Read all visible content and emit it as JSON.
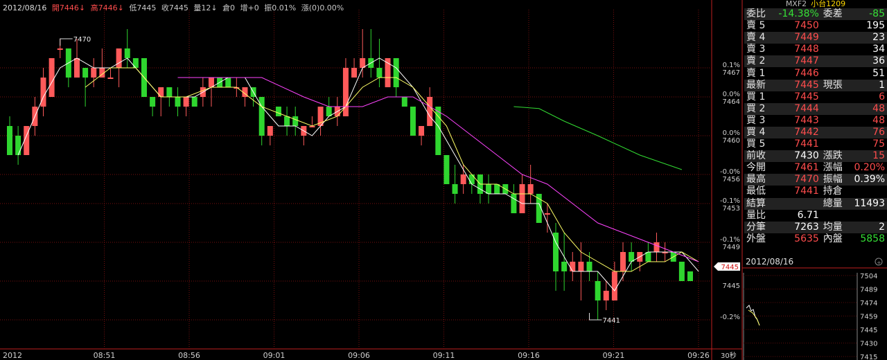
{
  "header": {
    "date": "2012/08/16",
    "open": "開7446↓",
    "high": "高7446↓",
    "low": "低7445",
    "close": "收7445",
    "volume": "量12↓",
    "oi": "倉0",
    "oi_change": "增+0",
    "amplitude": "振0.01%",
    "change": "漲(0)0.00%"
  },
  "side_panel": {
    "code": "MXF2",
    "title": "小台1209",
    "ratio_label": "委比",
    "ratio_value": "-14.38%",
    "diff_label": "委差",
    "diff_value": "-85",
    "asks": [
      {
        "label": "賣 5",
        "price": "7450",
        "qty": "195"
      },
      {
        "label": "賣 4",
        "price": "7449",
        "qty": "23"
      },
      {
        "label": "賣 3",
        "price": "7448",
        "qty": "34"
      },
      {
        "label": "賣 2",
        "price": "7447",
        "qty": "36"
      },
      {
        "label": "賣 1",
        "price": "7446",
        "qty": "51"
      }
    ],
    "last": {
      "label": "最新",
      "price": "7445",
      "qty_label": "現張",
      "qty": "1"
    },
    "bids": [
      {
        "label": "買 1",
        "price": "7445",
        "qty": "6"
      },
      {
        "label": "買 2",
        "price": "7444",
        "qty": "48"
      },
      {
        "label": "買 3",
        "price": "7443",
        "qty": "48"
      },
      {
        "label": "買 4",
        "price": "7442",
        "qty": "76"
      },
      {
        "label": "買 5",
        "price": "7441",
        "qty": "75"
      }
    ],
    "stats": {
      "prev_close_label": "前收",
      "prev_close": "7430",
      "chg_label": "漲跌",
      "chg": "15",
      "open_label": "今開",
      "open": "7461",
      "chg_pct_label": "漲幅",
      "chg_pct": "0.20%",
      "high_label": "最高",
      "high": "7470",
      "amp_label": "振幅",
      "amp": "0.39%",
      "low_label": "最低",
      "low": "7441",
      "oi_label": "持倉",
      "oi": "",
      "settle_label": "結算",
      "settle": "",
      "total_label": "總量",
      "total": "11493",
      "vol_ratio_label": "量比",
      "vol_ratio": "6.71",
      "trades_label": "分筆",
      "trades": "7263",
      "avg_label": "均量",
      "avg": "2",
      "outer_label": "外盤",
      "outer": "5635",
      "inner_label": "內盤",
      "inner": "5858"
    },
    "mini_date": "2012/08/16",
    "mini_ticks": [
      "7504",
      "7489",
      "7474",
      "7459",
      "7445",
      "7430",
      "7415"
    ]
  },
  "chart_data": {
    "type": "candlestick",
    "price_range": [
      7438,
      7473
    ],
    "y_ticks": [
      {
        "price": 7467,
        "label": "7467",
        "pct": "0.1%"
      },
      {
        "price": 7464,
        "label": "7464",
        "pct": "0.0%"
      },
      {
        "price": 7460,
        "label": "7460",
        "pct": "0.0%"
      },
      {
        "price": 7456,
        "label": "7456",
        "pct": "-0.0%"
      },
      {
        "price": 7453,
        "label": "7453",
        "pct": "-0.1%"
      },
      {
        "price": 7449,
        "label": "7449",
        "pct": "-0.1%"
      },
      {
        "price": 7445,
        "label": "7445",
        "pct": ""
      },
      {
        "price": 7441,
        "label": "",
        "pct": "-0.2%"
      }
    ],
    "current_price": "7445",
    "x_labels": [
      "2012",
      "08:51",
      "08:56",
      "09:01",
      "09:06",
      "09:11",
      "09:16",
      "09:21",
      "09:26"
    ],
    "x_unit": "30秒",
    "high_marker": "7470",
    "low_marker": "7441",
    "candles": [
      {
        "o": 7461,
        "h": 7462,
        "l": 7459,
        "c": 7458
      },
      {
        "o": 7460,
        "h": 7461,
        "l": 7457,
        "c": 7458
      },
      {
        "o": 7458,
        "h": 7461,
        "l": 7458,
        "c": 7461
      },
      {
        "o": 7461,
        "h": 7464,
        "l": 7460,
        "c": 7463
      },
      {
        "o": 7463,
        "h": 7467,
        "l": 7462,
        "c": 7466
      },
      {
        "o": 7464,
        "h": 7467,
        "l": 7464,
        "c": 7468
      },
      {
        "o": 7469,
        "h": 7470,
        "l": 7468,
        "c": 7469
      },
      {
        "o": 7469,
        "h": 7469,
        "l": 7465,
        "c": 7466
      },
      {
        "o": 7466,
        "h": 7470,
        "l": 7466,
        "c": 7468
      },
      {
        "o": 7467,
        "h": 7467,
        "l": 7463,
        "c": 7466
      },
      {
        "o": 7466,
        "h": 7468,
        "l": 7465,
        "c": 7467
      },
      {
        "o": 7466,
        "h": 7469,
        "l": 7466,
        "c": 7467
      },
      {
        "o": 7466,
        "h": 7467,
        "l": 7466,
        "c": 7466
      },
      {
        "o": 7467,
        "h": 7469,
        "l": 7465,
        "c": 7469
      },
      {
        "o": 7469,
        "h": 7471,
        "l": 7467,
        "c": 7468
      },
      {
        "o": 7468,
        "h": 7468,
        "l": 7467,
        "c": 7467
      },
      {
        "o": 7468,
        "h": 7468,
        "l": 7464,
        "c": 7464
      },
      {
        "o": 7464,
        "h": 7464,
        "l": 7462,
        "c": 7463
      },
      {
        "o": 7464,
        "h": 7465,
        "l": 7462,
        "c": 7465
      },
      {
        "o": 7465,
        "h": 7465,
        "l": 7463,
        "c": 7464
      },
      {
        "o": 7464,
        "h": 7465,
        "l": 7462,
        "c": 7463
      },
      {
        "o": 7463,
        "h": 7464,
        "l": 7462,
        "c": 7464
      },
      {
        "o": 7464,
        "h": 7464,
        "l": 7463,
        "c": 7463
      },
      {
        "o": 7464,
        "h": 7466,
        "l": 7463,
        "c": 7465
      },
      {
        "o": 7465,
        "h": 7465,
        "l": 7463,
        "c": 7466
      },
      {
        "o": 7466,
        "h": 7466,
        "l": 7465,
        "c": 7465
      },
      {
        "o": 7466,
        "h": 7466,
        "l": 7465,
        "c": 7465
      },
      {
        "o": 7465,
        "h": 7466,
        "l": 7464,
        "c": 7465
      },
      {
        "o": 7464,
        "h": 7465,
        "l": 7463,
        "c": 7465
      },
      {
        "o": 7465,
        "h": 7465,
        "l": 7463,
        "c": 7464
      },
      {
        "o": 7464,
        "h": 7464,
        "l": 7459,
        "c": 7460
      },
      {
        "o": 7460,
        "h": 7461,
        "l": 7459,
        "c": 7461
      },
      {
        "o": 7463,
        "h": 7463,
        "l": 7462,
        "c": 7462
      },
      {
        "o": 7462,
        "h": 7463,
        "l": 7460,
        "c": 7461
      },
      {
        "o": 7462,
        "h": 7463,
        "l": 7460,
        "c": 7461
      },
      {
        "o": 7460,
        "h": 7461,
        "l": 7459,
        "c": 7461
      },
      {
        "o": 7461,
        "h": 7462,
        "l": 7461,
        "c": 7461
      },
      {
        "o": 7461,
        "h": 7463,
        "l": 7460,
        "c": 7463
      },
      {
        "o": 7463,
        "h": 7464,
        "l": 7462,
        "c": 7462
      },
      {
        "o": 7462,
        "h": 7464,
        "l": 7461,
        "c": 7463
      },
      {
        "o": 7462,
        "h": 7468,
        "l": 7462,
        "c": 7467
      },
      {
        "o": 7466,
        "h": 7468,
        "l": 7466,
        "c": 7467
      },
      {
        "o": 7467,
        "h": 7471,
        "l": 7466,
        "c": 7468
      },
      {
        "o": 7468,
        "h": 7471,
        "l": 7466,
        "c": 7467
      },
      {
        "o": 7467,
        "h": 7470,
        "l": 7465,
        "c": 7466
      },
      {
        "o": 7465,
        "h": 7468,
        "l": 7465,
        "c": 7468
      },
      {
        "o": 7468,
        "h": 7468,
        "l": 7464,
        "c": 7465
      },
      {
        "o": 7464,
        "h": 7464,
        "l": 7463,
        "c": 7463
      },
      {
        "o": 7463,
        "h": 7463,
        "l": 7460,
        "c": 7460
      },
      {
        "o": 7460,
        "h": 7461,
        "l": 7459,
        "c": 7461
      },
      {
        "o": 7461,
        "h": 7465,
        "l": 7461,
        "c": 7464
      },
      {
        "o": 7463,
        "h": 7463,
        "l": 7458,
        "c": 7458
      },
      {
        "o": 7458,
        "h": 7458,
        "l": 7455,
        "c": 7455
      },
      {
        "o": 7455,
        "h": 7457,
        "l": 7453,
        "c": 7454
      },
      {
        "o": 7455,
        "h": 7457,
        "l": 7454,
        "c": 7456
      },
      {
        "o": 7456,
        "h": 7456,
        "l": 7454,
        "c": 7455
      },
      {
        "o": 7456,
        "h": 7456,
        "l": 7453,
        "c": 7454
      },
      {
        "o": 7455,
        "h": 7456,
        "l": 7453,
        "c": 7454
      },
      {
        "o": 7455,
        "h": 7455,
        "l": 7454,
        "c": 7454
      },
      {
        "o": 7455,
        "h": 7455,
        "l": 7454,
        "c": 7454
      },
      {
        "o": 7454,
        "h": 7455,
        "l": 7452,
        "c": 7452
      },
      {
        "o": 7452,
        "h": 7456,
        "l": 7452,
        "c": 7455
      },
      {
        "o": 7454,
        "h": 7457,
        "l": 7453,
        "c": 7455
      },
      {
        "o": 7454,
        "h": 7454,
        "l": 7451,
        "c": 7451
      },
      {
        "o": 7452,
        "h": 7453,
        "l": 7450,
        "c": 7452
      },
      {
        "o": 7450,
        "h": 7451,
        "l": 7444,
        "c": 7446
      },
      {
        "o": 7447,
        "h": 7450,
        "l": 7444,
        "c": 7446
      },
      {
        "o": 7446,
        "h": 7448,
        "l": 7445,
        "c": 7447
      },
      {
        "o": 7446,
        "h": 7449,
        "l": 7443,
        "c": 7447
      },
      {
        "o": 7447,
        "h": 7448,
        "l": 7445,
        "c": 7446
      },
      {
        "o": 7445,
        "h": 7446,
        "l": 7441,
        "c": 7443
      },
      {
        "o": 7443,
        "h": 7445,
        "l": 7442,
        "c": 7444
      },
      {
        "o": 7443,
        "h": 7447,
        "l": 7443,
        "c": 7446
      },
      {
        "o": 7446,
        "h": 7449,
        "l": 7445,
        "c": 7448
      },
      {
        "o": 7448,
        "h": 7449,
        "l": 7446,
        "c": 7447
      },
      {
        "o": 7447,
        "h": 7448,
        "l": 7446,
        "c": 7448
      },
      {
        "o": 7448,
        "h": 7449,
        "l": 7447,
        "c": 7447
      },
      {
        "o": 7448,
        "h": 7450,
        "l": 7447,
        "c": 7449
      },
      {
        "o": 7448,
        "h": 7449,
        "l": 7447,
        "c": 7448
      },
      {
        "o": 7448,
        "h": 7448,
        "l": 7447,
        "c": 7447
      },
      {
        "o": 7447,
        "h": 7447,
        "l": 7445,
        "c": 7445
      },
      {
        "o": 7446,
        "h": 7446,
        "l": 7445,
        "c": 7445
      }
    ],
    "ma_series": [
      {
        "color": "#ffffff",
        "points": [
          [
            1,
            7458
          ],
          [
            2,
            7460
          ],
          [
            3,
            7462
          ],
          [
            4,
            7464
          ],
          [
            6,
            7467
          ],
          [
            8,
            7468
          ],
          [
            10,
            7467
          ],
          [
            12,
            7467
          ],
          [
            14,
            7468
          ],
          [
            16,
            7466
          ],
          [
            18,
            7464
          ],
          [
            20,
            7464
          ],
          [
            22,
            7464
          ],
          [
            24,
            7465
          ],
          [
            26,
            7466
          ],
          [
            28,
            7466
          ],
          [
            30,
            7463
          ],
          [
            32,
            7461
          ],
          [
            34,
            7461
          ],
          [
            36,
            7460
          ],
          [
            38,
            7462
          ],
          [
            40,
            7463
          ],
          [
            42,
            7467
          ],
          [
            44,
            7468
          ],
          [
            46,
            7467
          ],
          [
            48,
            7465
          ],
          [
            50,
            7462
          ],
          [
            51,
            7461
          ],
          [
            53,
            7458
          ],
          [
            55,
            7455
          ],
          [
            57,
            7454
          ],
          [
            59,
            7454
          ],
          [
            61,
            7453
          ],
          [
            63,
            7453
          ],
          [
            65,
            7449
          ],
          [
            67,
            7446
          ],
          [
            69,
            7446
          ],
          [
            70,
            7446
          ],
          [
            72,
            7444
          ],
          [
            74,
            7447
          ],
          [
            76,
            7448
          ],
          [
            78,
            7448
          ],
          [
            80,
            7448
          ],
          [
            82,
            7446
          ]
        ]
      },
      {
        "color": "#ffff66",
        "points": [
          [
            9,
            7465
          ],
          [
            12,
            7467
          ],
          [
            15,
            7467
          ],
          [
            18,
            7464
          ],
          [
            21,
            7464
          ],
          [
            24,
            7465
          ],
          [
            27,
            7465
          ],
          [
            30,
            7463
          ],
          [
            33,
            7462
          ],
          [
            36,
            7461
          ],
          [
            39,
            7462
          ],
          [
            42,
            7465
          ],
          [
            44,
            7466
          ],
          [
            46,
            7466
          ],
          [
            48,
            7465
          ],
          [
            50,
            7463
          ],
          [
            52,
            7461
          ],
          [
            54,
            7457
          ],
          [
            56,
            7455
          ],
          [
            58,
            7455
          ],
          [
            60,
            7454
          ],
          [
            62,
            7454
          ],
          [
            64,
            7453
          ],
          [
            66,
            7450
          ],
          [
            68,
            7448
          ],
          [
            70,
            7447
          ],
          [
            72,
            7446
          ],
          [
            74,
            7446
          ],
          [
            76,
            7447
          ],
          [
            78,
            7447
          ],
          [
            80,
            7448
          ],
          [
            82,
            7447
          ]
        ]
      },
      {
        "color": "#ff44ff",
        "points": [
          [
            20,
            7466
          ],
          [
            25,
            7466
          ],
          [
            30,
            7466
          ],
          [
            35,
            7464
          ],
          [
            38,
            7463
          ],
          [
            42,
            7463
          ],
          [
            45,
            7464
          ],
          [
            48,
            7464
          ],
          [
            50,
            7463
          ],
          [
            52,
            7462
          ],
          [
            55,
            7460
          ],
          [
            58,
            7458
          ],
          [
            61,
            7456
          ],
          [
            64,
            7455
          ],
          [
            67,
            7453
          ],
          [
            70,
            7451
          ],
          [
            73,
            7450
          ],
          [
            76,
            7449
          ],
          [
            79,
            7448
          ],
          [
            82,
            7447
          ]
        ]
      },
      {
        "color": "#33dd33",
        "points": [
          [
            60,
            7463
          ],
          [
            63,
            7462.8
          ],
          [
            66,
            7461.5
          ],
          [
            70,
            7460
          ],
          [
            75,
            7458
          ],
          [
            80,
            7456.5
          ]
        ]
      }
    ]
  }
}
